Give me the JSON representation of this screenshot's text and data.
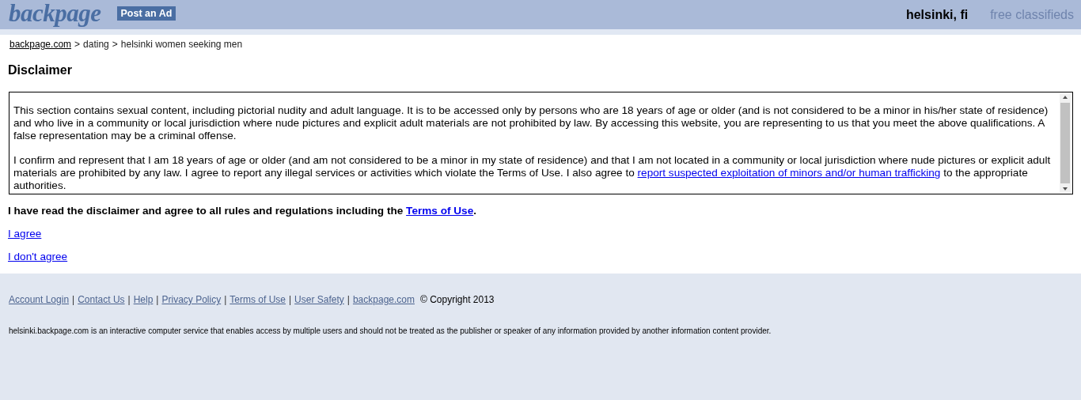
{
  "header": {
    "logo": "backpage",
    "post_button": "Post an Ad",
    "location": "helsinki, fi",
    "tagline": "free classifieds"
  },
  "breadcrumb": {
    "separator": ">",
    "home_link": "backpage.com",
    "items": [
      "dating",
      "helsinki women seeking men"
    ]
  },
  "heading": "Disclaimer",
  "disclaimer_box": {
    "paragraphs": [
      {
        "before": "This section contains sexual content, including pictorial nudity and adult language. It is to be accessed only by persons who are 18 years of age or older (and is not considered to be a minor in his/her state of residence) and who live in a community or local jurisdiction where nude pictures and explicit adult materials are not prohibited by law. By accessing this website, you are representing to us that you meet the above qualifications. A false representation may be a criminal offense."
      },
      {
        "before": "I confirm and represent that I am 18 years of age or older (and am not considered to be a minor in my state of residence) and that I am not located in a community or local jurisdiction where nude pictures or explicit adult materials are prohibited by any law. I agree to report any illegal services or activities which violate the Terms of Use. I also agree to ",
        "link": "report suspected exploitation of minors and/or human trafficking",
        "after": " to the appropriate authorities."
      }
    ]
  },
  "agreement": {
    "before": "I have read the disclaimer and agree to all rules and regulations including the ",
    "link": "Terms of Use",
    "after": "."
  },
  "choices": [
    "I agree",
    "I don't agree"
  ],
  "footer": {
    "separator": "|",
    "links": [
      "Account Login",
      "Contact Us",
      "Help",
      "Privacy Policy",
      "Terms of Use",
      "User Safety",
      "backpage.com"
    ],
    "copyright": "© Copyright 2013",
    "notice": "helsinki.backpage.com is an interactive computer service that enables access by multiple users and should not be treated as the publisher or speaker of any information provided by another information content provider."
  }
}
